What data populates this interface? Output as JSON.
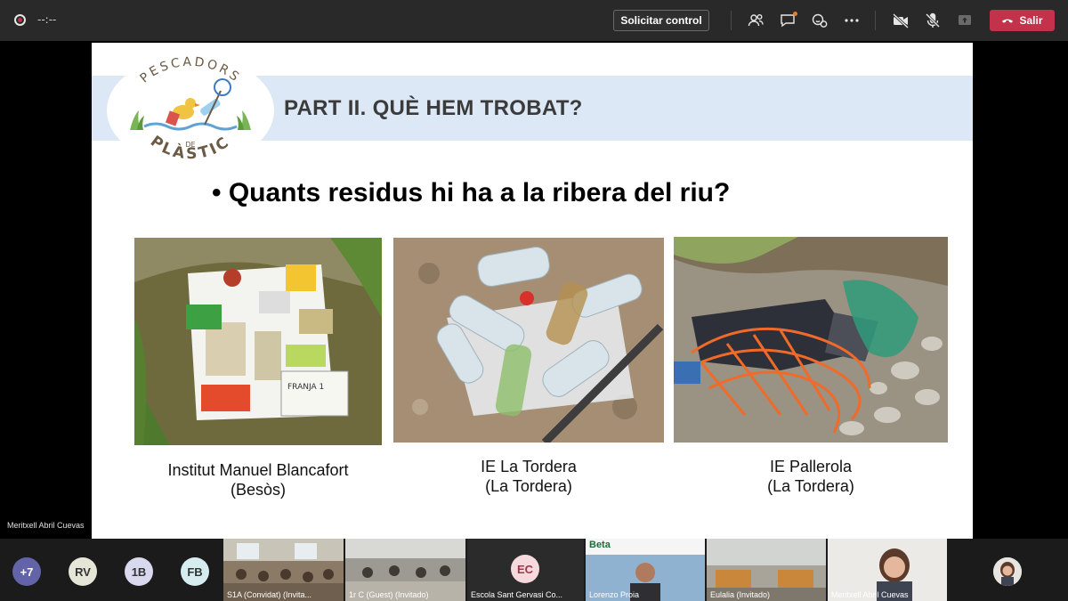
{
  "toolbar": {
    "timer": "--:--",
    "request_control_label": "Solicitar control",
    "leave_label": "Salir"
  },
  "slide": {
    "logo_text_top": "PESCADORS",
    "logo_text_mid": "DE",
    "logo_text_bottom": "PLÀSTIC",
    "title": "PART II. QUÈ HEM TROBAT?",
    "bullet": "• Quants residus hi ha a la ribera del riu?",
    "photos": [
      {
        "caption_line1": "Institut Manuel Blancafort",
        "caption_line2": "(Besòs)",
        "note_text": "FRANJA 1"
      },
      {
        "caption_line1": "IE La Tordera",
        "caption_line2": "(La Tordera)"
      },
      {
        "caption_line1": "IE Pallerola",
        "caption_line2": "(La Tordera)"
      }
    ]
  },
  "presenter_name": "Meritxell Abril Cuevas",
  "participants": {
    "more_count": "+7",
    "avatars": [
      {
        "initials": "RV",
        "color": "#e6e6d8"
      },
      {
        "initials": "1B",
        "color": "#d8d8ef"
      },
      {
        "initials": "FB",
        "color": "#d6edf0"
      }
    ],
    "tiles": [
      {
        "label": "S1A (Convidat) (Invita..."
      },
      {
        "label": "1r C (Guest) (Invitado)"
      },
      {
        "label": "Escola Sant Gervasi Co...",
        "initials": "EC"
      },
      {
        "label": "Lorenzo Proia",
        "banner": "Beta"
      },
      {
        "label": "Eulalia (Invitado)"
      },
      {
        "label": "Meritxell Abril Cuevas"
      }
    ]
  },
  "colors": {
    "leave": "#c4314b",
    "header_band": "#dce8f5",
    "toolbar": "#292929"
  }
}
